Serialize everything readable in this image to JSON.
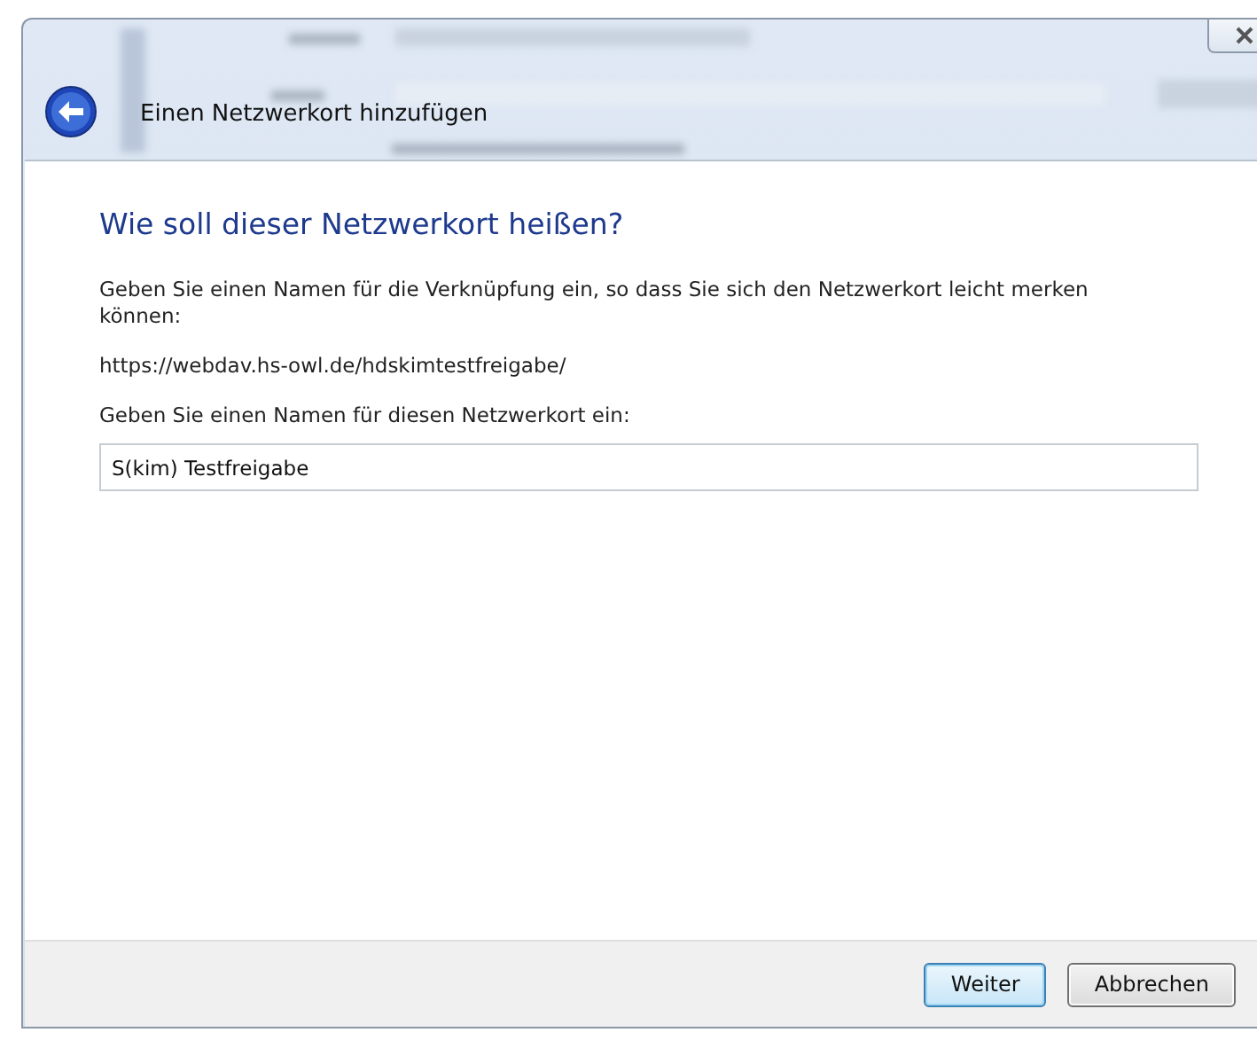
{
  "window": {
    "title": "Einen Netzwerkort hinzufügen"
  },
  "heading": "Wie soll dieser Netzwerkort heißen?",
  "description": "Geben Sie einen Namen für die Verknüpfung ein, so dass Sie sich den Netzwerkort leicht merken können:",
  "address": "https://webdav.hs-owl.de/hdskimtestfreigabe/",
  "name_field": {
    "label": "Geben Sie einen Namen für diesen Netzwerkort ein:",
    "value": "S(kim) Testfreigabe"
  },
  "buttons": [
    {
      "label": "Weiter",
      "default": true
    },
    {
      "label": "Abbrechen",
      "default": false
    }
  ]
}
